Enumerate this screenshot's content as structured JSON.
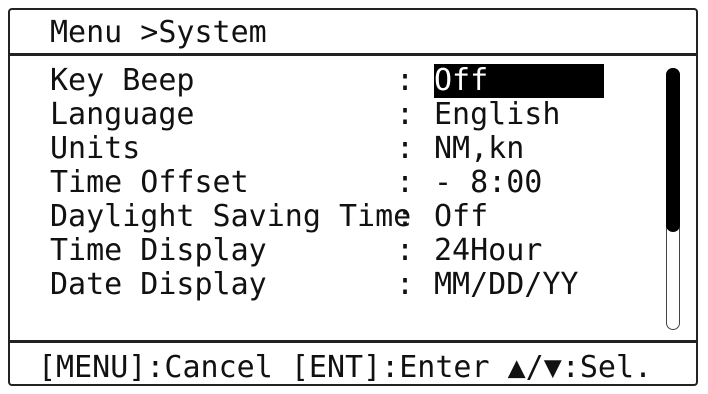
{
  "header": {
    "title": "Menu >System"
  },
  "menu": {
    "items": [
      {
        "label": "Key Beep",
        "value": "Off",
        "selected": true
      },
      {
        "label": "Language",
        "value": "English",
        "selected": false
      },
      {
        "label": "Units",
        "value": "NM,kn",
        "selected": false
      },
      {
        "label": "Time Offset",
        "value": "- 8:00",
        "selected": false
      },
      {
        "label": "Daylight Saving Time",
        "value": "Off",
        "selected": false
      },
      {
        "label": "Time Display",
        "value": "24Hour",
        "selected": false
      },
      {
        "label": "Date Display",
        "value": "MM/DD/YY",
        "selected": false
      }
    ],
    "separator": ":"
  },
  "footer": {
    "help": "[MENU]:Cancel [ENT]:Enter ▲/▼:Sel."
  },
  "colors": {
    "foreground": "#111111",
    "background": "#ffffff",
    "selection_bg": "#000000",
    "selection_fg": "#ffffff"
  },
  "icons": {
    "up": "triangle-up-icon",
    "down": "triangle-down-icon"
  }
}
